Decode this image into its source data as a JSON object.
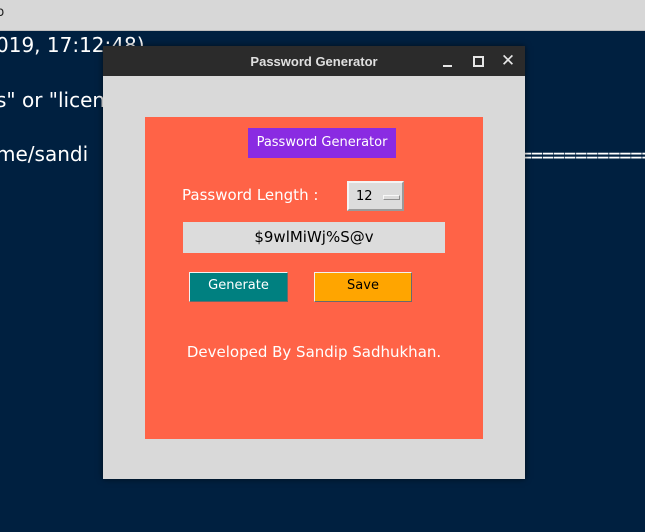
{
  "terminal": {
    "title_fragment": "p",
    "lines": [
      "019, 17:12:48)",
      "s\" or \"licen",
      "me/sandi"
    ],
    "rule": "=============="
  },
  "window": {
    "title": "Password Generator"
  },
  "app": {
    "heading": "Password Generator",
    "length_label": "Password Length :",
    "length_value": "12",
    "password": "$9wlMiWj%S@v",
    "generate_label": "Generate",
    "save_label": "Save",
    "footer": "Developed By Sandip Sadhukhan."
  },
  "colors": {
    "panel": "#ff6347",
    "heading_bg": "#8a2be2",
    "generate_bg": "#008080",
    "save_bg": "#ffa500",
    "desktop_bg": "#002040"
  }
}
